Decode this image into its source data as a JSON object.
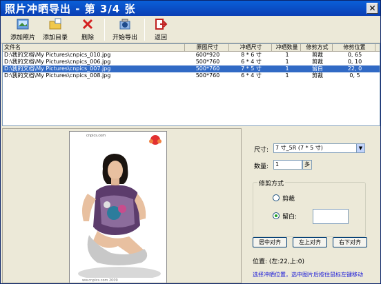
{
  "window": {
    "title": "照片冲晒导出 - 第 3/4 张",
    "close_glyph": "✕"
  },
  "toolbar": [
    {
      "label": "添加照片",
      "icon": "add-photo-icon"
    },
    {
      "label": "添加目录",
      "icon": "add-folder-icon"
    },
    {
      "label": "删除",
      "icon": "delete-icon"
    },
    {
      "label": "开始导出",
      "icon": "export-icon"
    },
    {
      "label": "返回",
      "icon": "return-icon"
    }
  ],
  "table": {
    "columns": [
      "文件名",
      "原图尺寸",
      "冲晒尺寸",
      "冲晒数量",
      "修剪方式",
      "修剪位置"
    ],
    "rows": [
      [
        "D:\\我的文档\\My Pictures\\cnpics_010.jpg",
        "600*920",
        "8 * 6 寸",
        "1",
        "剪裁",
        "0, 65"
      ],
      [
        "D:\\我的文档\\My Pictures\\cnpics_006.jpg",
        "500*760",
        "6 * 4 寸",
        "1",
        "剪裁",
        "0, 10"
      ],
      [
        "D:\\我的文档\\My Pictures\\cnpics_007.jpg",
        "500*760",
        "7 * 5 寸",
        "1",
        "留白",
        "22, 0"
      ],
      [
        "D:\\我的文档\\My Pictures\\cnpics_008.jpg",
        "500*760",
        "6 * 4 寸",
        "1",
        "剪裁",
        "0, 5"
      ]
    ],
    "selected_index": 2
  },
  "preview": {
    "site_text": "cnpics.com",
    "footer_text": "ww.cnpics.com 2009"
  },
  "options": {
    "size_label": "尺寸:",
    "size_value": "7 寸_5R (7 * 5 寸)",
    "qty_label": "数量:",
    "qty_value": "1",
    "qty_button": "多",
    "group_title": "修剪方式",
    "radio_crop": "剪裁",
    "radio_blank": "留白:",
    "btn_center": "居中对齐",
    "btn_topleft": "左上对齐",
    "btn_bottomright": "右下对齐",
    "position_text": "位置: (左:22,上:0)",
    "hint": "选择冲晒位置，选中图片后按住鼠标左键移动"
  },
  "colors": {
    "title_bar": "#0a4fc8",
    "selection": "#316ac5",
    "hint": "#1818d8"
  }
}
